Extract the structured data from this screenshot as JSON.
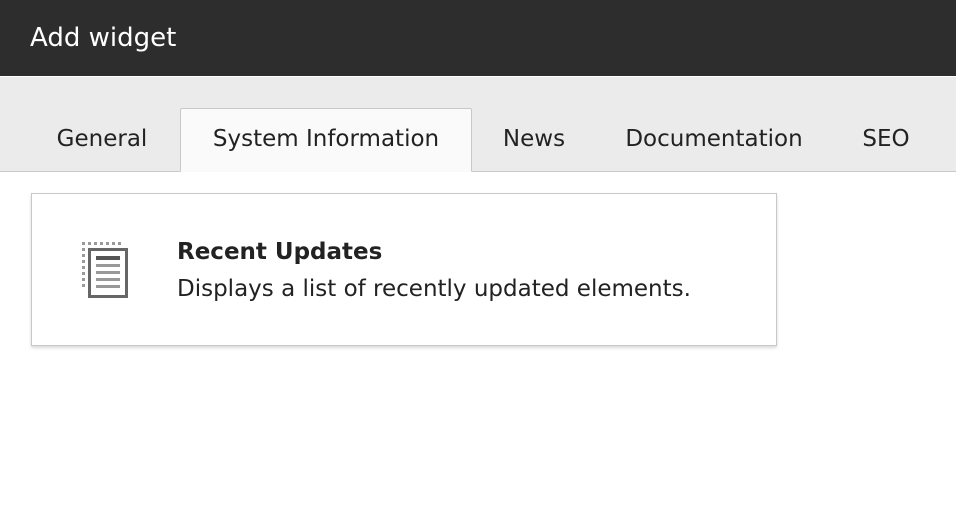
{
  "modal": {
    "title": "Add widget"
  },
  "tabs": [
    {
      "label": "General",
      "active": false
    },
    {
      "label": "System Information",
      "active": true
    },
    {
      "label": "News",
      "active": false
    },
    {
      "label": "Documentation",
      "active": false
    },
    {
      "label": "SEO",
      "active": false
    }
  ],
  "widgets": [
    {
      "icon": "document-list-icon",
      "title": "Recent Updates",
      "description": "Displays a list of recently updated elements."
    }
  ],
  "colors": {
    "header_bg": "#2d2d2d",
    "tab_bar_bg": "#ebebeb",
    "active_tab_bg": "#fafafa",
    "border": "#c8c8c8",
    "text": "#222222"
  }
}
